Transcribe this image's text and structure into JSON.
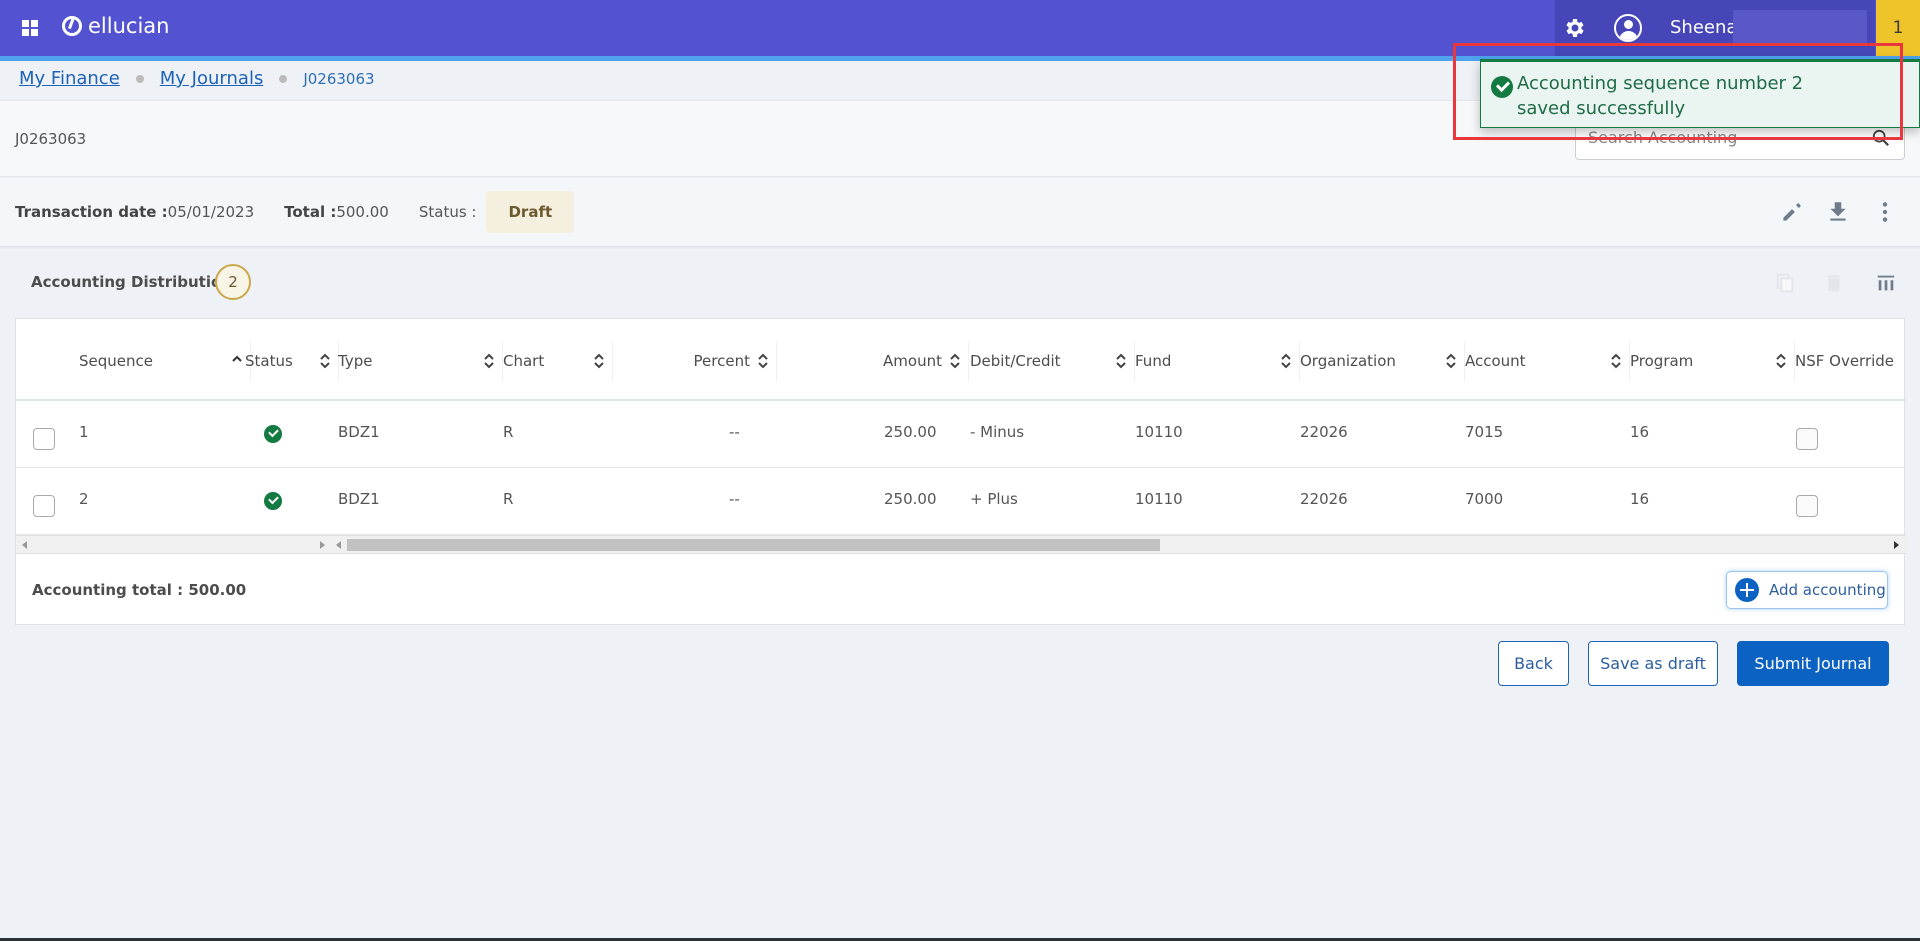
{
  "header": {
    "app_name": "ellucian",
    "user_name": "Sheena",
    "notification_count": "1",
    "icons": [
      "apps-grid-icon",
      "ellucian-logo-icon",
      "gear-icon",
      "user-avatar-icon"
    ]
  },
  "breadcrumb": {
    "items": [
      {
        "label": "My Finance"
      },
      {
        "label": "My Journals"
      }
    ],
    "current": "J0263063"
  },
  "page": {
    "title": "J0263063",
    "search_placeholder": "Search Accounting"
  },
  "info": {
    "transaction_date_label": "Transaction date :",
    "transaction_date": "05/01/2023",
    "total_label": "Total :",
    "total": "500.00",
    "status_label": "Status :",
    "status": "Draft",
    "actions": [
      "edit-icon",
      "download-icon",
      "more-vert-icon"
    ]
  },
  "distribution": {
    "title": "Accounting Distribution",
    "count": "2",
    "toolbar": [
      "copy-icon",
      "delete-icon",
      "columns-icon"
    ],
    "columns": [
      {
        "label": "Sequence",
        "sort": "asc"
      },
      {
        "label": "Status",
        "sort": "none"
      },
      {
        "label": "Type",
        "sort": "none"
      },
      {
        "label": "Chart",
        "sort": "none"
      },
      {
        "label": "Percent",
        "sort": "none"
      },
      {
        "label": "Amount",
        "sort": "none"
      },
      {
        "label": "Debit/Credit",
        "sort": "none"
      },
      {
        "label": "Fund",
        "sort": "none"
      },
      {
        "label": "Organization",
        "sort": "none"
      },
      {
        "label": "Account",
        "sort": "none"
      },
      {
        "label": "Program",
        "sort": "none"
      },
      {
        "label": "NSF Override",
        "sort": "none"
      }
    ],
    "rows": [
      {
        "sequence": "1",
        "status": "valid",
        "type": "BDZ1",
        "chart": "R",
        "percent": "--",
        "amount": "250.00",
        "debit_credit": "- Minus",
        "fund": "10110",
        "organization": "22026",
        "account": "7015",
        "program": "16",
        "nsf_override": false,
        "selected": false
      },
      {
        "sequence": "2",
        "status": "valid",
        "type": "BDZ1",
        "chart": "R",
        "percent": "--",
        "amount": "250.00",
        "debit_credit": "+ Plus",
        "fund": "10110",
        "organization": "22026",
        "account": "7000",
        "program": "16",
        "nsf_override": false,
        "selected": false
      }
    ],
    "total_label": "Accounting total : 500.00",
    "add_button": "Add accounting"
  },
  "footer": {
    "back": "Back",
    "save_draft": "Save as draft",
    "submit": "Submit Journal"
  },
  "toast": {
    "message": "Accounting sequence number 2 saved successfully",
    "type": "success"
  },
  "colors": {
    "header": "#5353d1",
    "accent": "#4fa3ef",
    "primary": "#0b62c3",
    "success": "#137a41",
    "badge": "#efc32a",
    "highlight": "#e8383d"
  }
}
